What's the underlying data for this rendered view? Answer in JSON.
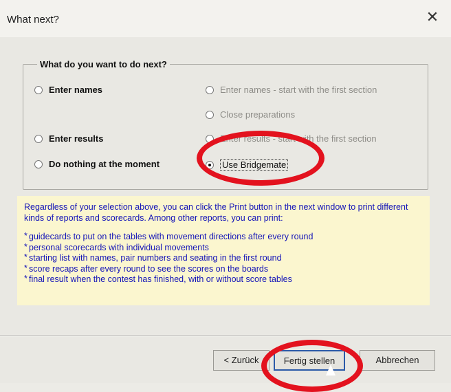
{
  "window": {
    "title": "What next?",
    "close_glyph": "✕"
  },
  "group": {
    "legend": "What do you want to do next?",
    "options": [
      {
        "label": "Enter names",
        "selected": false,
        "enabled": true
      },
      {
        "label": "Enter names - start with the first section",
        "selected": false,
        "enabled": false
      },
      {
        "label": "Close preparations",
        "selected": false,
        "enabled": false
      },
      {
        "label": "Enter results",
        "selected": false,
        "enabled": true
      },
      {
        "label": "Enter results - start with the first section",
        "selected": false,
        "enabled": false
      },
      {
        "label": "Do nothing at the moment",
        "selected": false,
        "enabled": true
      },
      {
        "label": "Use Bridgemate",
        "selected": true,
        "enabled": true
      }
    ]
  },
  "info": {
    "paragraph": "Regardless of your selection above, you can click the Print button in the next window to print different kinds of reports and scorecards. Among other reports, you can print:",
    "items": [
      "guidecards to put on the tables with movement directions after every round",
      "personal scorecards with individual movements",
      "starting list with names, pair numbers and seating in the first round",
      "score recaps after every round to see the scores on the boards",
      "final result when the contest has finished, with or without score tables"
    ]
  },
  "buttons": {
    "back": "< Zurück",
    "finish": "Fertig stellen",
    "cancel": "Abbrechen"
  },
  "colors": {
    "info_text": "#1414b8",
    "info_background": "#fbf6cf",
    "highlight_ring": "#e3121e"
  }
}
